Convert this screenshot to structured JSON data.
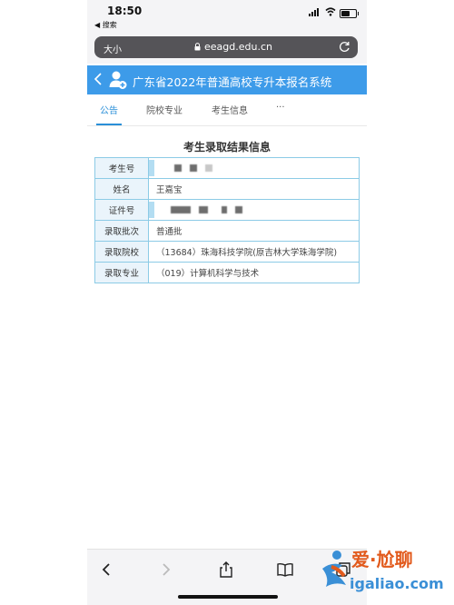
{
  "status_bar": {
    "time": "18:50",
    "back_app": "◀ 搜索"
  },
  "browser": {
    "text_size": "大小",
    "url": "eeagd.edu.cn"
  },
  "header": {
    "title": "广东省2022年普通高校专升本报名系统"
  },
  "tabs": [
    {
      "label": "公告"
    },
    {
      "label": "院校专业"
    },
    {
      "label": "考生信息"
    },
    {
      "label": "···"
    }
  ],
  "result": {
    "title": "考生录取结果信息",
    "rows": [
      {
        "label": "考生号",
        "value": ""
      },
      {
        "label": "姓名",
        "value": "王嘉宝"
      },
      {
        "label": "证件号",
        "value": ""
      },
      {
        "label": "录取批次",
        "value": "普通批"
      },
      {
        "label": "录取院校",
        "value": "（13684）珠海科技学院(原吉林大学珠海学院)"
      },
      {
        "label": "录取专业",
        "value": "（019）计算机科学与技术"
      }
    ]
  },
  "watermark": {
    "main": "爱·尬聊",
    "sub": "igaliao.com"
  },
  "colors": {
    "header_bg": "#3d9be9",
    "active_tab": "#2a8fd8",
    "table_border": "#8ccbe6"
  }
}
